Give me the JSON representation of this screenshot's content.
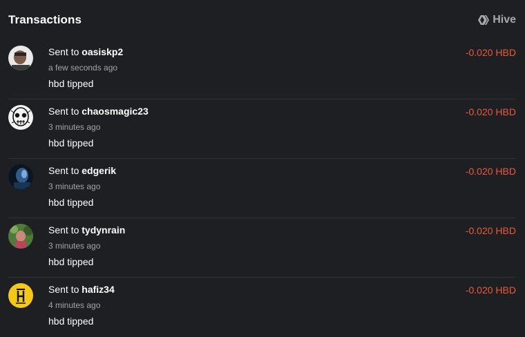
{
  "header": {
    "title": "Transactions",
    "brand": "Hive"
  },
  "colors": {
    "background": "#1e1f23",
    "amount": "#ec5a3a",
    "muted": "#a3a5aa",
    "divider": "#303237"
  },
  "transactions": [
    {
      "prefix": "Sent to",
      "user": "oasiskp2",
      "time": "a few seconds ago",
      "memo": "hbd tipped",
      "amount": "-0.020 HBD",
      "avatar_icon": "person-photo-avatar"
    },
    {
      "prefix": "Sent to",
      "user": "chaosmagic23",
      "time": "3 minutes ago",
      "memo": "hbd tipped",
      "amount": "-0.020 HBD",
      "avatar_icon": "skull-drawing-avatar"
    },
    {
      "prefix": "Sent to",
      "user": "edgerik",
      "time": "3 minutes ago",
      "memo": "hbd tipped",
      "amount": "-0.020 HBD",
      "avatar_icon": "blue-figure-avatar"
    },
    {
      "prefix": "Sent to",
      "user": "tydynrain",
      "time": "3 minutes ago",
      "memo": "hbd tipped",
      "amount": "-0.020 HBD",
      "avatar_icon": "garden-photo-avatar"
    },
    {
      "prefix": "Sent to",
      "user": "hafiz34",
      "time": "4 minutes ago",
      "memo": "hbd tipped",
      "amount": "-0.020 HBD",
      "avatar_icon": "yellow-logo-avatar"
    }
  ]
}
